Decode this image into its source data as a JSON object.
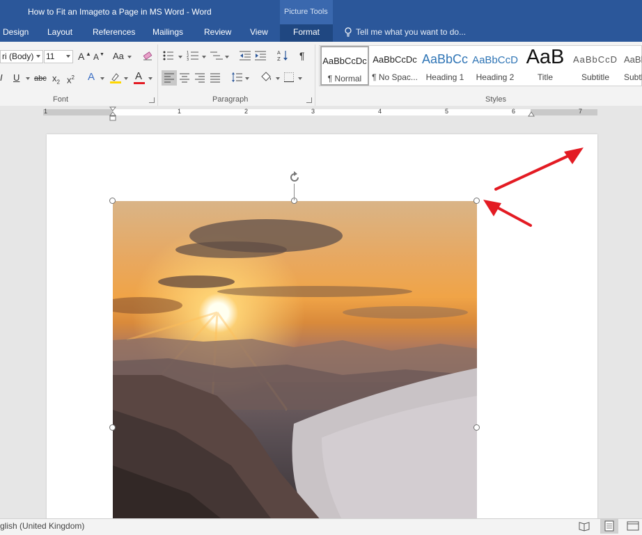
{
  "window": {
    "title": "How to Fit an Imageto a Page in MS Word - Word"
  },
  "context": {
    "label": "Picture Tools"
  },
  "tabs": [
    "Design",
    "Layout",
    "References",
    "Mailings",
    "Review",
    "View",
    "Format"
  ],
  "tell_me": {
    "placeholder": "Tell me what you want to do..."
  },
  "font": {
    "name_value": "ri (Body)",
    "size_value": "11",
    "grow_label": "A",
    "shrink_label": "A",
    "case_label": "Aa",
    "bold": "I",
    "underline": "U",
    "strike": "abc",
    "subscript": "x",
    "superscript": "x",
    "effects": "A",
    "font_color": "A",
    "group_label": "Font"
  },
  "paragraph": {
    "group_label": "Paragraph",
    "pilcrow": "¶"
  },
  "styles": {
    "group_label": "Styles",
    "items": [
      {
        "sample": "AaBbCcDc",
        "name": "¶ Normal"
      },
      {
        "sample": "AaBbCcDc",
        "name": "¶ No Spac..."
      },
      {
        "sample": "AaBbCc",
        "name": "Heading 1"
      },
      {
        "sample": "AaBbCcD",
        "name": "Heading 2"
      },
      {
        "sample": "AaB",
        "name": "Title"
      },
      {
        "sample": "AaBbCcD",
        "name": "Subtitle"
      },
      {
        "sample": "AaBbCcD",
        "name": "Subtl"
      }
    ]
  },
  "ruler": {
    "numbers": [
      "1",
      "1",
      "2",
      "3",
      "4",
      "5",
      "6",
      "7"
    ]
  },
  "status": {
    "language": "glish (United Kingdom)"
  },
  "colors": {
    "title_bar": "#2b579a",
    "annotation_arrow": "#e31b23",
    "highlight_yellow": "#ffd700",
    "font_color_red": "#e31b23"
  },
  "icons": {
    "lightbulb": "lightbulb-icon",
    "clear_formatting": "eraser-icon",
    "rotate": "rotate-icon",
    "read_mode": "book-icon",
    "print_layout": "page-icon",
    "web_layout": "web-icon"
  }
}
